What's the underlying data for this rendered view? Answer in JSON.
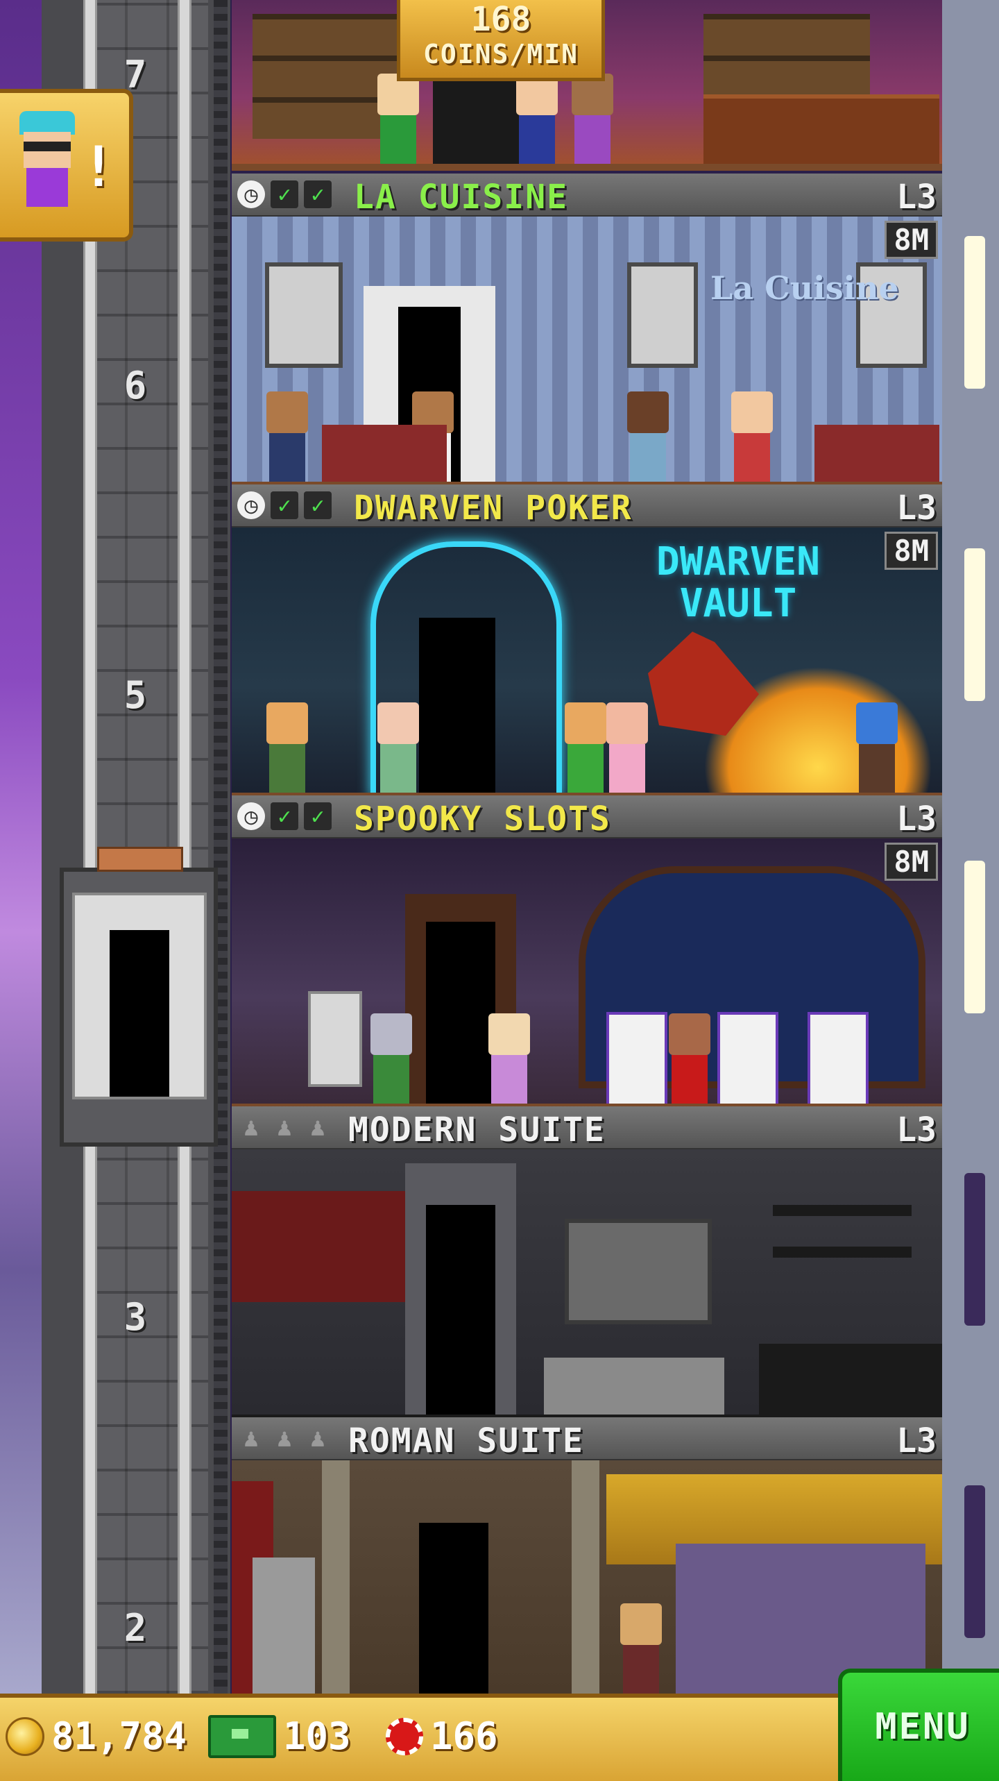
{
  "shaft": {
    "floor_numbers": [
      "7",
      "6",
      "5",
      "3",
      "2"
    ]
  },
  "banner": {
    "coins_value": "168",
    "coins_unit": "COINS/MIN"
  },
  "floors": [
    {
      "name": "LA CUISINE",
      "level": "L3",
      "stock": "8M",
      "name_color": "#8aef4a",
      "status": "stocked"
    },
    {
      "name": "DWARVEN POKER",
      "level": "L3",
      "stock": "8M",
      "name_color": "#f2e84a",
      "status": "stocked"
    },
    {
      "name": "SPOOKY SLOTS",
      "level": "L3",
      "stock": "8M",
      "name_color": "#f2e84a",
      "status": "stocked"
    },
    {
      "name": "MODERN SUITE",
      "level": "L3",
      "name_color": "#f2f2f2",
      "status": "residential"
    },
    {
      "name": "ROMAN SUITE",
      "level": "L3",
      "name_color": "#f2f2f2",
      "status": "residential"
    }
  ],
  "room_signs": {
    "la_cuisine": "La Cuisine",
    "dwarven_vault": "DWARVEN VAULT"
  },
  "bottom_bar": {
    "coins": "81,784",
    "bux": "103",
    "chips": "166",
    "menu_label": "MENU"
  },
  "colors": {
    "gold": "#e8b020",
    "green_button": "#2ac82a",
    "floor_bar": "#666666"
  }
}
